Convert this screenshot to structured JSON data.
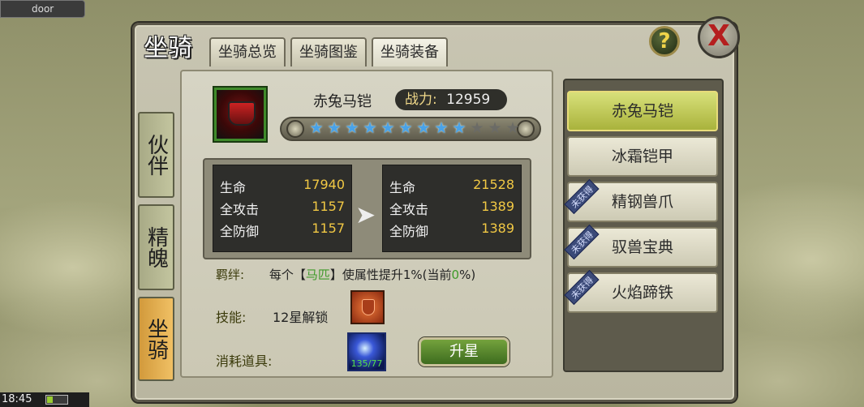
{
  "top_tag": "door",
  "status_time": "18:45",
  "window_title": "坐骑",
  "tabs": [
    {
      "label": "坐骑总览"
    },
    {
      "label": "坐骑图鉴"
    },
    {
      "label": "坐骑装备"
    }
  ],
  "help_icon": "?",
  "close_icon": "X",
  "side_tabs": [
    {
      "label": "伙伴"
    },
    {
      "label": "精魄"
    },
    {
      "label": "坐骑"
    }
  ],
  "item": {
    "name": "赤兔马铠",
    "power_label": "战力:",
    "power_value": "12959",
    "stars_total": 12,
    "stars_on": 9
  },
  "stats_current": [
    {
      "k": "生命",
      "v": "17940"
    },
    {
      "k": "全攻击",
      "v": "1157"
    },
    {
      "k": "全防御",
      "v": "1157"
    }
  ],
  "stats_next": [
    {
      "k": "生命",
      "v": "21528"
    },
    {
      "k": "全攻击",
      "v": "1389"
    },
    {
      "k": "全防御",
      "v": "1389"
    }
  ],
  "bond": {
    "label": "羁绊:",
    "pre": "每个【",
    "highlight": "马匹",
    "mid": "】使属性提升1%(当前",
    "current": "0",
    "post": "%)"
  },
  "skill": {
    "label": "技能:",
    "text": "12星解锁"
  },
  "consume": {
    "label": "消耗道具:",
    "count": "135/77"
  },
  "upgrade_label": "升星",
  "equip_list": [
    {
      "label": "赤兔马铠",
      "ribbon": ""
    },
    {
      "label": "冰霜铠甲",
      "ribbon": ""
    },
    {
      "label": "精钢兽爪",
      "ribbon": "未获得"
    },
    {
      "label": "驭兽宝典",
      "ribbon": "未获得"
    },
    {
      "label": "火焰蹄铁",
      "ribbon": "未获得"
    }
  ]
}
